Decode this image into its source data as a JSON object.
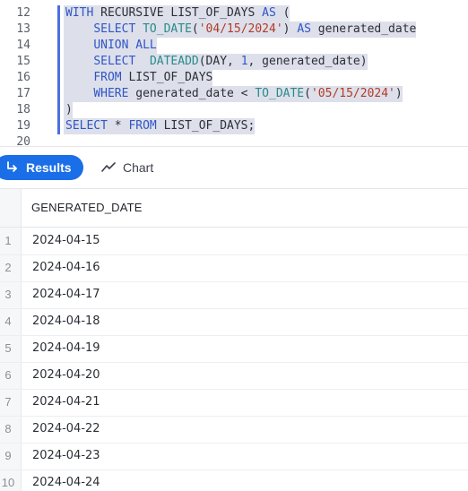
{
  "editor": {
    "lines": [
      {
        "num": "12",
        "selected": true,
        "tokens": [
          [
            "kw",
            "WITH"
          ],
          [
            "id",
            " RECURSIVE LIST_OF_DAYS "
          ],
          [
            "kw",
            "AS"
          ],
          [
            "id",
            " ("
          ]
        ]
      },
      {
        "num": "13",
        "selected": true,
        "tokens": [
          [
            "id",
            "    "
          ],
          [
            "kw",
            "SELECT"
          ],
          [
            "id",
            " "
          ],
          [
            "fn",
            "TO_DATE"
          ],
          [
            "id",
            "("
          ],
          [
            "str",
            "'04/15/2024'"
          ],
          [
            "id",
            ") "
          ],
          [
            "kw",
            "AS"
          ],
          [
            "id",
            " generated_date"
          ]
        ]
      },
      {
        "num": "14",
        "selected": true,
        "tokens": [
          [
            "id",
            "    "
          ],
          [
            "kw",
            "UNION ALL"
          ]
        ]
      },
      {
        "num": "15",
        "selected": true,
        "tokens": [
          [
            "id",
            "    "
          ],
          [
            "kw",
            "SELECT"
          ],
          [
            "id",
            "  "
          ],
          [
            "fn",
            "DATEADD"
          ],
          [
            "id",
            "(DAY, "
          ],
          [
            "num",
            "1"
          ],
          [
            "id",
            ", generated_date)"
          ]
        ]
      },
      {
        "num": "16",
        "selected": true,
        "tokens": [
          [
            "id",
            "    "
          ],
          [
            "kw",
            "FROM"
          ],
          [
            "id",
            " LIST_OF_DAYS"
          ]
        ]
      },
      {
        "num": "17",
        "selected": true,
        "tokens": [
          [
            "id",
            "    "
          ],
          [
            "kw",
            "WHERE"
          ],
          [
            "id",
            " generated_date < "
          ],
          [
            "fn",
            "TO_DATE"
          ],
          [
            "id",
            "("
          ],
          [
            "str",
            "'05/15/2024'"
          ],
          [
            "id",
            ")"
          ]
        ]
      },
      {
        "num": "18",
        "selected": true,
        "tokens": [
          [
            "id",
            ")"
          ]
        ]
      },
      {
        "num": "19",
        "selected": true,
        "tokens": [
          [
            "kw",
            "SELECT"
          ],
          [
            "id",
            " * "
          ],
          [
            "kw",
            "FROM"
          ],
          [
            "id",
            " LIST_OF_DAYS;"
          ]
        ]
      },
      {
        "num": "20",
        "selected": false,
        "tokens": []
      }
    ]
  },
  "tabs": {
    "results_label": "Results",
    "results_icon": "return-arrow-icon",
    "chart_label": "Chart",
    "chart_icon": "line-chart-icon",
    "active_color": "#1a6ee8"
  },
  "table": {
    "columns": [
      "GENERATED_DATE"
    ],
    "rows": [
      {
        "index": "1",
        "value": "2024-04-15"
      },
      {
        "index": "2",
        "value": "2024-04-16"
      },
      {
        "index": "3",
        "value": "2024-04-17"
      },
      {
        "index": "4",
        "value": "2024-04-18"
      },
      {
        "index": "5",
        "value": "2024-04-19"
      },
      {
        "index": "6",
        "value": "2024-04-20"
      },
      {
        "index": "7",
        "value": "2024-04-21"
      },
      {
        "index": "8",
        "value": "2024-04-22"
      },
      {
        "index": "9",
        "value": "2024-04-23"
      },
      {
        "index": "10",
        "value": "2024-04-24"
      }
    ]
  }
}
